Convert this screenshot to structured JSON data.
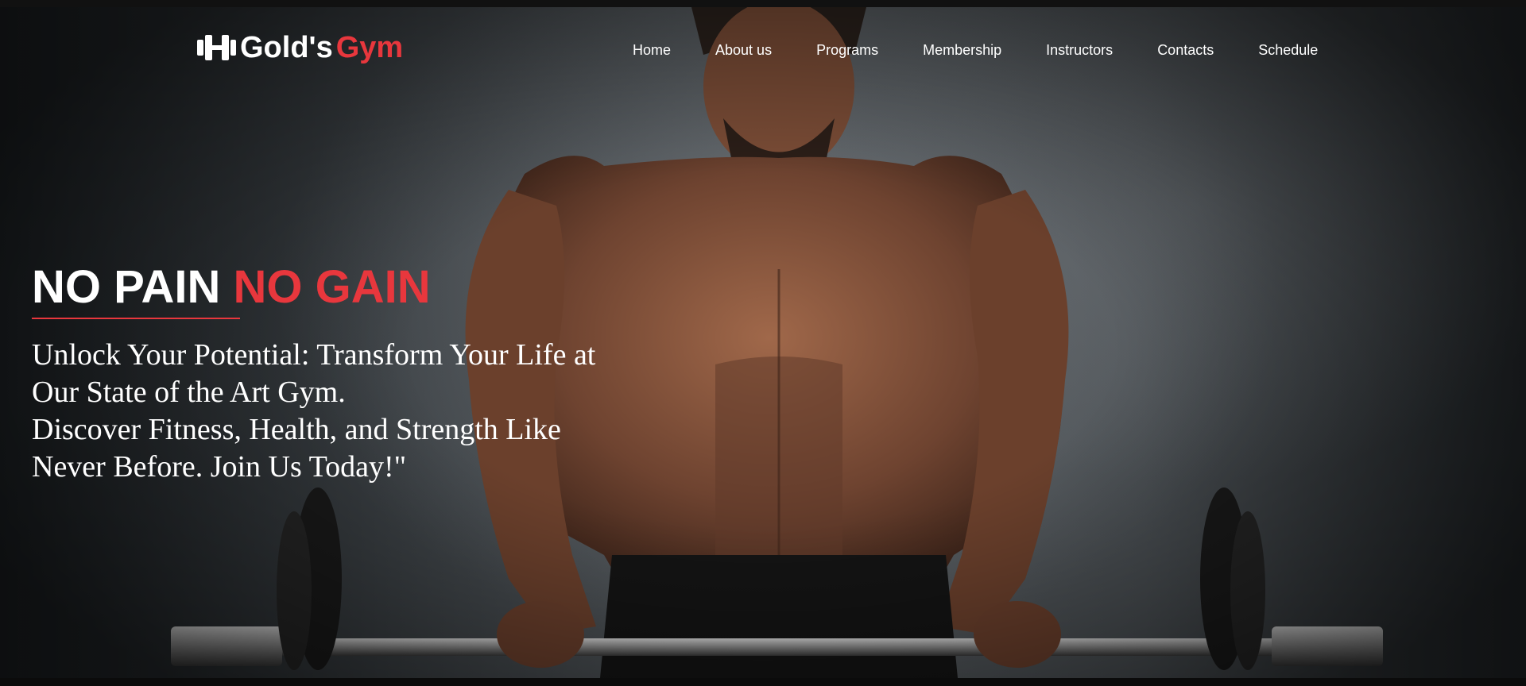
{
  "brand": {
    "name_main": "Gold's",
    "name_accent": "Gym",
    "icon": "dumbbell-icon",
    "accent_color": "#e8373d"
  },
  "nav": {
    "items": [
      {
        "label": "Home"
      },
      {
        "label": "About us"
      },
      {
        "label": "Programs"
      },
      {
        "label": "Membership"
      },
      {
        "label": "Instructors"
      },
      {
        "label": "Contacts"
      },
      {
        "label": "Schedule"
      }
    ]
  },
  "hero": {
    "headline_white": "NO PAIN",
    "headline_red": "NO GAIN",
    "tagline_line1": "Unlock Your Potential: Transform Your Life at Our State of the Art Gym.",
    "tagline_line2": "Discover Fitness, Health, and Strength Like Never Before. Join Us Today!\""
  }
}
